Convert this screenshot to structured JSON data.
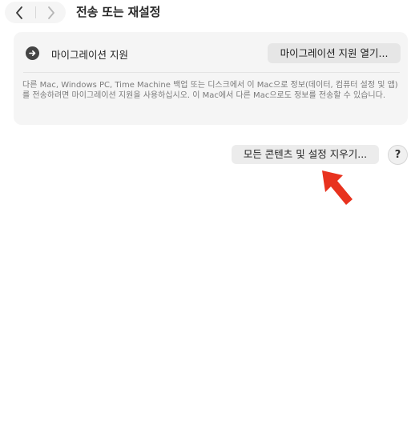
{
  "window": {
    "title": "전송 또는 재설정",
    "back_icon": "chevron-left-icon",
    "forward_icon": "chevron-right-icon"
  },
  "migration": {
    "icon": "arrow-circle-right-icon",
    "label": "마이그레이션 지원",
    "open_button": "마이그레이션 지원 열기...",
    "description": "다른 Mac, Windows PC, Time Machine 백업 또는 디스크에서 이 Mac으로 정보(데이터, 컴퓨터 설정 및 앱)를 전송하려면 마이그레이션 지원을 사용하십시오. 이 Mac에서 다른 Mac으로도 정보를 전송할 수 있습니다."
  },
  "reset": {
    "erase_button": "모든 콘텐츠 및 설정 지우기...",
    "help_button": "?"
  },
  "annotation": {
    "arrow_icon": "red-pointer-arrow-icon",
    "arrow_color": "#e8321e"
  }
}
